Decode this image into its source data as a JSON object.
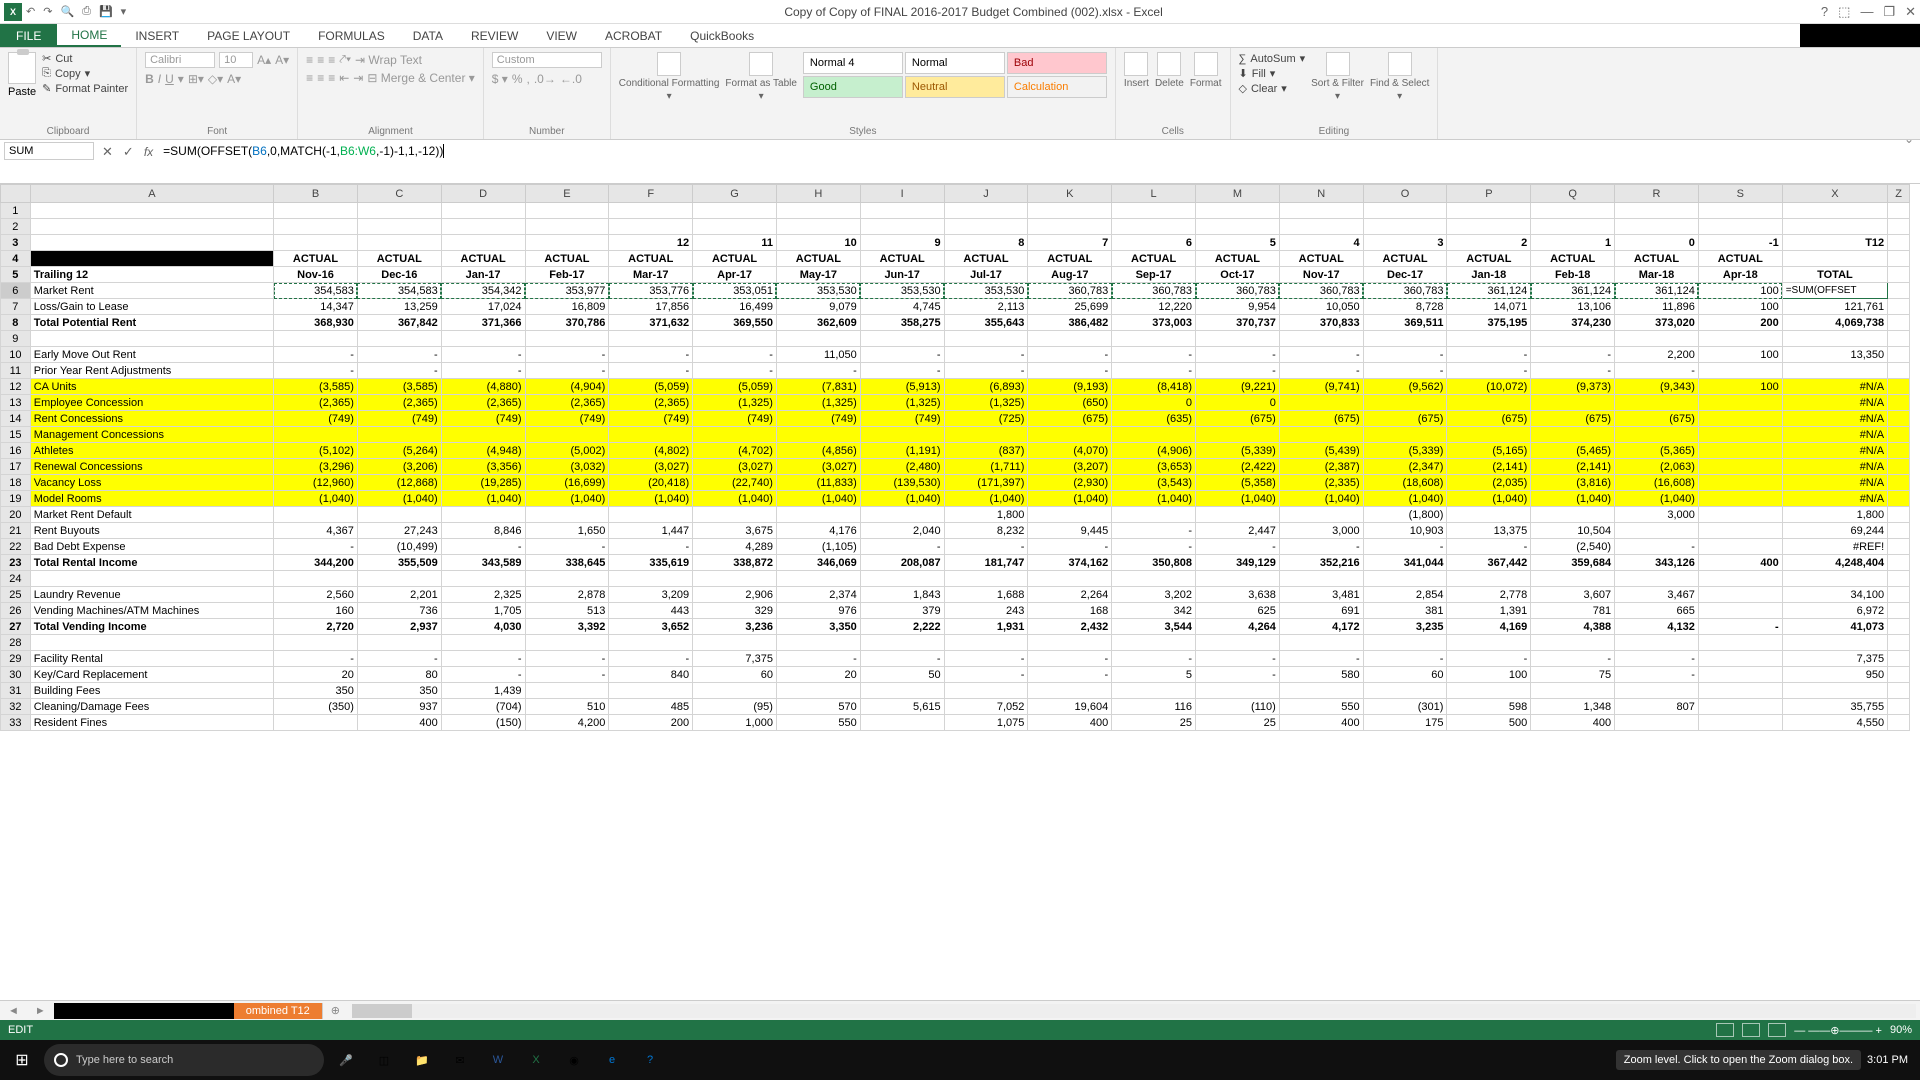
{
  "title": "Copy of Copy of FINAL 2016-2017 Budget Combined (002).xlsx - Excel",
  "qat": [
    "↶",
    "↷",
    "🔍",
    "⎙",
    "💾",
    "▾"
  ],
  "wincontrols": [
    "?",
    "⬚",
    "—",
    "❐",
    "✕"
  ],
  "tabs": {
    "file": "FILE",
    "items": [
      "HOME",
      "INSERT",
      "PAGE LAYOUT",
      "FORMULAS",
      "DATA",
      "REVIEW",
      "VIEW",
      "ACROBAT",
      "QuickBooks"
    ],
    "active": "HOME"
  },
  "clipboard": {
    "paste": "Paste",
    "cut": "Cut",
    "copy": "Copy",
    "fmtpainter": "Format Painter",
    "label": "Clipboard"
  },
  "font": {
    "name": "Calibri",
    "size": "10",
    "label": "Font",
    "bold": "B",
    "italic": "I",
    "underline": "U"
  },
  "alignment": {
    "wrap": "Wrap Text",
    "merge": "Merge & Center",
    "label": "Alignment"
  },
  "number": {
    "format": "Custom",
    "label": "Number"
  },
  "condfmt": "Conditional Formatting",
  "fmttable": "Format as Table",
  "styles": {
    "label": "Styles",
    "items": [
      "Normal 4",
      "Normal",
      "Bad",
      "Good",
      "Neutral",
      "Calculation"
    ]
  },
  "cells": {
    "insert": "Insert",
    "delete": "Delete",
    "format": "Format",
    "label": "Cells"
  },
  "editing": {
    "autosum": "AutoSum",
    "fill": "Fill",
    "clear": "Clear",
    "sort": "Sort & Filter",
    "find": "Find & Select",
    "label": "Editing"
  },
  "namebox": "SUM",
  "formula_plain": "=SUM(OFFSET(B6,0,MATCH(-1,B6:W6,-1)-1,1,-12))",
  "columns": [
    "",
    "A",
    "B",
    "C",
    "D",
    "E",
    "F",
    "G",
    "H",
    "I",
    "J",
    "K",
    "L",
    "M",
    "N",
    "O",
    "P",
    "Q",
    "R",
    "S",
    "X"
  ],
  "chart_data": {
    "type": "table",
    "row_numbers": [
      1,
      2,
      3,
      4,
      5,
      6,
      7,
      8,
      9,
      10,
      11,
      12,
      13,
      14,
      15,
      16,
      17,
      18,
      19,
      20,
      21,
      22,
      23,
      24,
      25,
      26,
      27,
      28,
      29,
      30,
      31,
      32,
      33
    ],
    "row3": [
      "",
      "",
      "",
      "",
      "",
      "12",
      "11",
      "10",
      "9",
      "8",
      "7",
      "6",
      "5",
      "4",
      "3",
      "2",
      "1",
      "0",
      "-1",
      "T12"
    ],
    "row4": [
      "",
      "ACTUAL",
      "ACTUAL",
      "ACTUAL",
      "ACTUAL",
      "ACTUAL",
      "ACTUAL",
      "ACTUAL",
      "ACTUAL",
      "ACTUAL",
      "ACTUAL",
      "ACTUAL",
      "ACTUAL",
      "ACTUAL",
      "ACTUAL",
      "ACTUAL",
      "ACTUAL",
      "ACTUAL",
      "ACTUAL",
      ""
    ],
    "row5": [
      "Trailing 12",
      "Nov-16",
      "Dec-16",
      "Jan-17",
      "Feb-17",
      "Mar-17",
      "Apr-17",
      "May-17",
      "Jun-17",
      "Jul-17",
      "Aug-17",
      "Sep-17",
      "Oct-17",
      "Nov-17",
      "Dec-17",
      "Jan-18",
      "Feb-18",
      "Mar-18",
      "Apr-18",
      "TOTAL"
    ],
    "rows": [
      {
        "n": 6,
        "label": "Market Rent",
        "vals": [
          "354,583",
          "354,583",
          "354,342",
          "353,977",
          "353,776",
          "353,051",
          "353,530",
          "353,530",
          "353,530",
          "360,783",
          "360,783",
          "360,783",
          "360,783",
          "360,783",
          "361,124",
          "361,124",
          "361,124",
          "100",
          "=SUM(OFFSET"
        ],
        "editing": true,
        "marching": true
      },
      {
        "n": 7,
        "label": "Loss/Gain to Lease",
        "vals": [
          "14,347",
          "13,259",
          "17,024",
          "16,809",
          "17,856",
          "16,499",
          "9,079",
          "4,745",
          "2,113",
          "25,699",
          "12,220",
          "9,954",
          "10,050",
          "8,728",
          "14,071",
          "13,106",
          "11,896",
          "100",
          "121,761"
        ]
      },
      {
        "n": 8,
        "label": "Total Potential Rent",
        "bold": true,
        "vals": [
          "368,930",
          "367,842",
          "371,366",
          "370,786",
          "371,632",
          "369,550",
          "362,609",
          "358,275",
          "355,643",
          "386,482",
          "373,003",
          "370,737",
          "370,833",
          "369,511",
          "375,195",
          "374,230",
          "373,020",
          "200",
          "4,069,738"
        ]
      },
      {
        "n": 9,
        "label": "",
        "vals": [
          "",
          "",
          "",
          "",
          "",
          "",
          "",
          "",
          "",
          "",
          "",
          "",
          "",
          "",
          "",
          "",
          "",
          "",
          ""
        ]
      },
      {
        "n": 10,
        "label": "Early Move Out Rent",
        "vals": [
          "-",
          "-",
          "-",
          "-",
          "-",
          "-",
          "11,050",
          "-",
          "-",
          "-",
          "-",
          "-",
          "-",
          "-",
          "-",
          "-",
          "2,200",
          "100",
          "13,350"
        ]
      },
      {
        "n": 11,
        "label": "Prior Year Rent Adjustments",
        "vals": [
          "-",
          "-",
          "-",
          "-",
          "-",
          "-",
          "-",
          "-",
          "-",
          "-",
          "-",
          "-",
          "-",
          "-",
          "-",
          "-",
          "-",
          "",
          ""
        ]
      },
      {
        "n": 12,
        "label": "CA Units",
        "yellow": true,
        "vals": [
          "(3,585)",
          "(3,585)",
          "(4,880)",
          "(4,904)",
          "(5,059)",
          "(5,059)",
          "(7,831)",
          "(5,913)",
          "(6,893)",
          "(9,193)",
          "(8,418)",
          "(9,221)",
          "(9,741)",
          "(9,562)",
          "(10,072)",
          "(9,373)",
          "(9,343)",
          "100",
          "#N/A"
        ]
      },
      {
        "n": 13,
        "label": "Employee Concession",
        "yellow": true,
        "vals": [
          "(2,365)",
          "(2,365)",
          "(2,365)",
          "(2,365)",
          "(2,365)",
          "(1,325)",
          "(1,325)",
          "(1,325)",
          "(1,325)",
          "(650)",
          "0",
          "0",
          "",
          "",
          "",
          "",
          "",
          "",
          "#N/A"
        ]
      },
      {
        "n": 14,
        "label": "Rent Concessions",
        "yellow": true,
        "vals": [
          "(749)",
          "(749)",
          "(749)",
          "(749)",
          "(749)",
          "(749)",
          "(749)",
          "(749)",
          "(725)",
          "(675)",
          "(635)",
          "(675)",
          "(675)",
          "(675)",
          "(675)",
          "(675)",
          "(675)",
          "",
          "#N/A"
        ]
      },
      {
        "n": 15,
        "label": "Management Concessions",
        "yellow": true,
        "vals": [
          "",
          "",
          "",
          "",
          "",
          "",
          "",
          "",
          "",
          "",
          "",
          "",
          "",
          "",
          "",
          "",
          "",
          "",
          "#N/A"
        ]
      },
      {
        "n": 16,
        "label": "Athletes",
        "yellow": true,
        "vals": [
          "(5,102)",
          "(5,264)",
          "(4,948)",
          "(5,002)",
          "(4,802)",
          "(4,702)",
          "(4,856)",
          "(1,191)",
          "(837)",
          "(4,070)",
          "(4,906)",
          "(5,339)",
          "(5,439)",
          "(5,339)",
          "(5,165)",
          "(5,465)",
          "(5,365)",
          "",
          "#N/A"
        ]
      },
      {
        "n": 17,
        "label": "Renewal Concessions",
        "yellow": true,
        "vals": [
          "(3,296)",
          "(3,206)",
          "(3,356)",
          "(3,032)",
          "(3,027)",
          "(3,027)",
          "(3,027)",
          "(2,480)",
          "(1,711)",
          "(3,207)",
          "(3,653)",
          "(2,422)",
          "(2,387)",
          "(2,347)",
          "(2,141)",
          "(2,141)",
          "(2,063)",
          "",
          "#N/A"
        ]
      },
      {
        "n": 18,
        "label": "Vacancy Loss",
        "yellow": true,
        "vals": [
          "(12,960)",
          "(12,868)",
          "(19,285)",
          "(16,699)",
          "(20,418)",
          "(22,740)",
          "(11,833)",
          "(139,530)",
          "(171,397)",
          "(2,930)",
          "(3,543)",
          "(5,358)",
          "(2,335)",
          "(18,608)",
          "(2,035)",
          "(3,816)",
          "(16,608)",
          "",
          "#N/A"
        ]
      },
      {
        "n": 19,
        "label": "Model Rooms",
        "yellow": true,
        "vals": [
          "(1,040)",
          "(1,040)",
          "(1,040)",
          "(1,040)",
          "(1,040)",
          "(1,040)",
          "(1,040)",
          "(1,040)",
          "(1,040)",
          "(1,040)",
          "(1,040)",
          "(1,040)",
          "(1,040)",
          "(1,040)",
          "(1,040)",
          "(1,040)",
          "(1,040)",
          "",
          "#N/A"
        ]
      },
      {
        "n": 20,
        "label": "Market Rent Default",
        "vals": [
          "",
          "",
          "",
          "",
          "",
          "",
          "",
          "",
          "1,800",
          "",
          "",
          "",
          "",
          "(1,800)",
          "",
          "",
          "3,000",
          "",
          "1,800"
        ]
      },
      {
        "n": 21,
        "label": "Rent Buyouts",
        "vals": [
          "4,367",
          "27,243",
          "8,846",
          "1,650",
          "1,447",
          "3,675",
          "4,176",
          "2,040",
          "8,232",
          "9,445",
          "-",
          "2,447",
          "3,000",
          "10,903",
          "13,375",
          "10,504",
          "",
          "",
          "69,244"
        ]
      },
      {
        "n": 22,
        "label": "Bad Debt Expense",
        "vals": [
          "-",
          "(10,499)",
          "-",
          "-",
          "-",
          "4,289",
          "(1,105)",
          "-",
          "-",
          "-",
          "-",
          "-",
          "-",
          "-",
          "-",
          "(2,540)",
          "-",
          "",
          "#REF!"
        ]
      },
      {
        "n": 23,
        "label": "Total Rental Income",
        "bold": true,
        "vals": [
          "344,200",
          "355,509",
          "343,589",
          "338,645",
          "335,619",
          "338,872",
          "346,069",
          "208,087",
          "181,747",
          "374,162",
          "350,808",
          "349,129",
          "352,216",
          "341,044",
          "367,442",
          "359,684",
          "343,126",
          "400",
          "4,248,404"
        ]
      },
      {
        "n": 24,
        "label": "",
        "vals": [
          "",
          "",
          "",
          "",
          "",
          "",
          "",
          "",
          "",
          "",
          "",
          "",
          "",
          "",
          "",
          "",
          "",
          "",
          ""
        ]
      },
      {
        "n": 25,
        "label": "Laundry Revenue",
        "vals": [
          "2,560",
          "2,201",
          "2,325",
          "2,878",
          "3,209",
          "2,906",
          "2,374",
          "1,843",
          "1,688",
          "2,264",
          "3,202",
          "3,638",
          "3,481",
          "2,854",
          "2,778",
          "3,607",
          "3,467",
          "",
          "34,100"
        ]
      },
      {
        "n": 26,
        "label": "Vending Machines/ATM Machines",
        "vals": [
          "160",
          "736",
          "1,705",
          "513",
          "443",
          "329",
          "976",
          "379",
          "243",
          "168",
          "342",
          "625",
          "691",
          "381",
          "1,391",
          "781",
          "665",
          "",
          "6,972"
        ]
      },
      {
        "n": 27,
        "label": "Total Vending Income",
        "bold": true,
        "vals": [
          "2,720",
          "2,937",
          "4,030",
          "3,392",
          "3,652",
          "3,236",
          "3,350",
          "2,222",
          "1,931",
          "2,432",
          "3,544",
          "4,264",
          "4,172",
          "3,235",
          "4,169",
          "4,388",
          "4,132",
          "-",
          "41,073"
        ]
      },
      {
        "n": 28,
        "label": "",
        "vals": [
          "",
          "",
          "",
          "",
          "",
          "",
          "",
          "",
          "",
          "",
          "",
          "",
          "",
          "",
          "",
          "",
          "",
          "",
          ""
        ]
      },
      {
        "n": 29,
        "label": "Facility Rental",
        "vals": [
          "-",
          "-",
          "-",
          "-",
          "-",
          "7,375",
          "-",
          "-",
          "-",
          "-",
          "-",
          "-",
          "-",
          "-",
          "-",
          "-",
          "-",
          "",
          "7,375"
        ]
      },
      {
        "n": 30,
        "label": "Key/Card Replacement",
        "vals": [
          "20",
          "80",
          "-",
          "-",
          "840",
          "60",
          "20",
          "50",
          "-",
          "-",
          "5",
          "-",
          "580",
          "60",
          "100",
          "75",
          "-",
          "",
          "950"
        ]
      },
      {
        "n": 31,
        "label": "Building Fees",
        "vals": [
          "350",
          "350",
          "1,439",
          "",
          "",
          "",
          "",
          "",
          "",
          "",
          "",
          "",
          "",
          "",
          "",
          "",
          "",
          "",
          ""
        ]
      },
      {
        "n": 32,
        "label": "Cleaning/Damage Fees",
        "vals": [
          "(350)",
          "937",
          "(704)",
          "510",
          "485",
          "(95)",
          "570",
          "5,615",
          "7,052",
          "19,604",
          "116",
          "(110)",
          "550",
          "(301)",
          "598",
          "1,348",
          "807",
          "",
          "35,755"
        ]
      },
      {
        "n": 33,
        "label": "Resident Fines",
        "vals": [
          "",
          "400",
          "(150)",
          "4,200",
          "200",
          "1,000",
          "550",
          "",
          "1,075",
          "400",
          "25",
          "25",
          "400",
          "175",
          "500",
          "400",
          "",
          "",
          "4,550"
        ]
      }
    ]
  },
  "sheet_tab": "ombined T12",
  "status": {
    "mode": "EDIT",
    "zoom": "90%",
    "hint": "Zoom level. Click to open the Zoom dialog box."
  },
  "taskbar": {
    "search_placeholder": "Type here to search",
    "time": "3:01 PM"
  }
}
